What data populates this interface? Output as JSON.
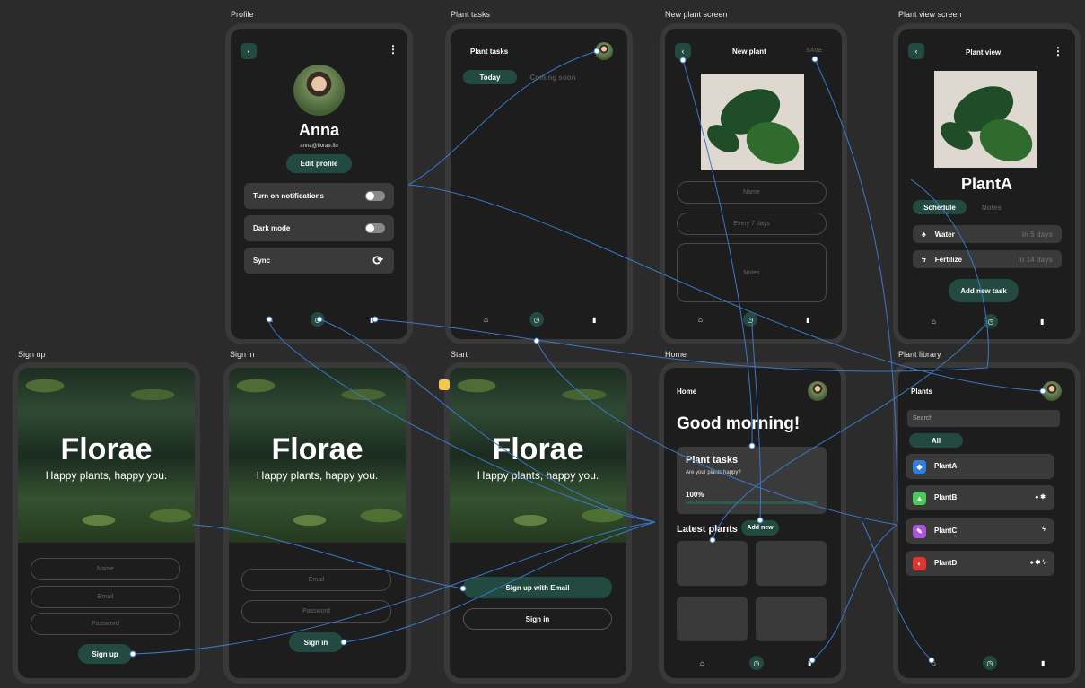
{
  "colors": {
    "accent": "#234a40",
    "wire": "#3b78c9",
    "background": "#2b2b2b",
    "screen": "#1d1d1d"
  },
  "frames": {
    "profile": {
      "label": "Profile",
      "name": "Anna",
      "email": "anna@florae.flo",
      "edit_button": "Edit profile",
      "settings": [
        {
          "label": "Turn on notifications",
          "control": "toggle"
        },
        {
          "label": "Dark mode",
          "control": "toggle"
        },
        {
          "label": "Sync",
          "control": "sync-icon"
        }
      ]
    },
    "plant_tasks": {
      "label": "Plant tasks",
      "title": "Plant tasks",
      "tabs": [
        "Today",
        "Coming soon"
      ]
    },
    "new_plant": {
      "label": "New plant screen",
      "title": "New plant",
      "save": "SAVE",
      "fields": [
        "Name",
        "Every 7 days",
        "Notes"
      ]
    },
    "plant_view": {
      "label": "Plant view screen",
      "title": "Plant view",
      "plant_name": "PlantA",
      "tabs": [
        "Schedule",
        "Notes"
      ],
      "tasks": [
        {
          "label": "Water",
          "due": "in 5 days",
          "icon": "drop-icon"
        },
        {
          "label": "Fertilize",
          "due": "in 14 days",
          "icon": "bolt-icon"
        }
      ],
      "add_button": "Add new task"
    },
    "sign_up": {
      "label": "Sign up",
      "brand": "Florae",
      "tagline": "Happy plants, happy you.",
      "fields": [
        "Name",
        "Email",
        "Password"
      ],
      "button": "Sign up"
    },
    "sign_in": {
      "label": "Sign in",
      "brand": "Florae",
      "tagline": "Happy plants, happy you.",
      "fields": [
        "Email",
        "Password"
      ],
      "button": "Sign in"
    },
    "start": {
      "label": "Start",
      "brand": "Florae",
      "tagline": "Happy plants, happy you.",
      "primary_button": "Sign up with Email",
      "secondary_button": "Sign in"
    },
    "home": {
      "label": "Home",
      "title": "Home",
      "greeting": "Good morning!",
      "card_title": "Plant tasks",
      "card_sub": "Are your plants happy?",
      "progress_text": "100%",
      "progress": 1.0,
      "latest_title": "Latest plants",
      "add_new": "Add new"
    },
    "library": {
      "label": "Plant library",
      "title": "Plants",
      "search_placeholder": "Search",
      "filter": "All",
      "plants": [
        {
          "name": "PlantA",
          "color": "#2f7fe0",
          "extra": ""
        },
        {
          "name": "PlantB",
          "color": "#4cc95a",
          "extra": "♠ ✱"
        },
        {
          "name": "PlantC",
          "color": "#a855d9",
          "extra": "ϟ"
        },
        {
          "name": "PlantD",
          "color": "#e0352f",
          "extra": "♠ ✱ ϟ"
        }
      ]
    }
  }
}
